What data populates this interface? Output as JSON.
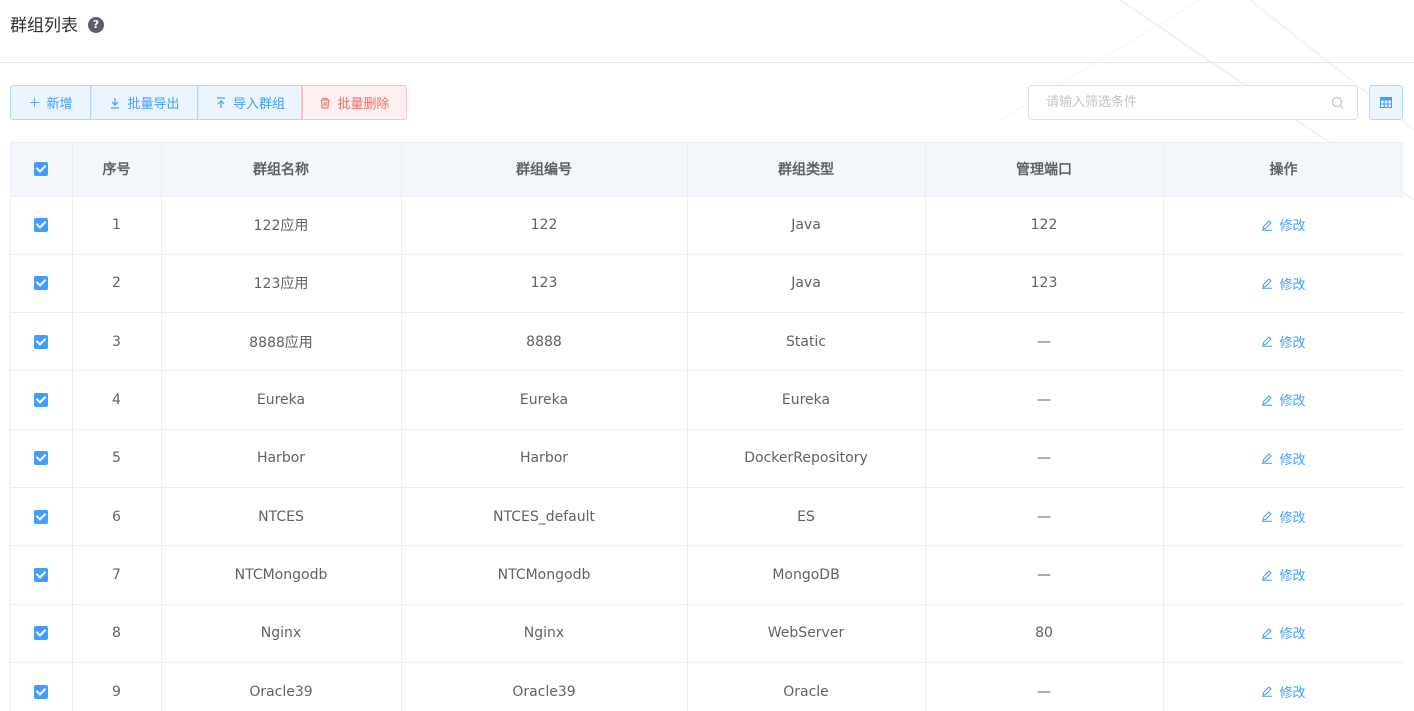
{
  "header": {
    "title": "群组列表",
    "help_symbol": "?"
  },
  "toolbar": {
    "add_label": "新增",
    "export_label": "批量导出",
    "import_label": "导入群组",
    "delete_label": "批量删除",
    "add_icon": "plus-icon",
    "export_icon": "download-icon",
    "import_icon": "upload-icon",
    "delete_icon": "trash-icon"
  },
  "search": {
    "placeholder": "请输入筛选条件",
    "value": ""
  },
  "colors": {
    "primary": "#409eff",
    "danger": "#f56c6c",
    "header_bg": "#f3f6fb"
  },
  "table": {
    "columns": [
      "序号",
      "群组名称",
      "群组编号",
      "群组类型",
      "管理端口",
      "操作"
    ],
    "action_label": "修改",
    "rows": [
      {
        "index": "1",
        "name": "122应用",
        "code": "122",
        "type": "Java",
        "port": "122",
        "checked": true
      },
      {
        "index": "2",
        "name": "123应用",
        "code": "123",
        "type": "Java",
        "port": "123",
        "checked": true
      },
      {
        "index": "3",
        "name": "8888应用",
        "code": "8888",
        "type": "Static",
        "port": "—",
        "checked": true
      },
      {
        "index": "4",
        "name": "Eureka",
        "code": "Eureka",
        "type": "Eureka",
        "port": "—",
        "checked": true
      },
      {
        "index": "5",
        "name": "Harbor",
        "code": "Harbor",
        "type": "DockerRepository",
        "port": "—",
        "checked": true
      },
      {
        "index": "6",
        "name": "NTCES",
        "code": "NTCES_default",
        "type": "ES",
        "port": "—",
        "checked": true
      },
      {
        "index": "7",
        "name": "NTCMongodb",
        "code": "NTCMongodb",
        "type": "MongoDB",
        "port": "—",
        "checked": true
      },
      {
        "index": "8",
        "name": "Nginx",
        "code": "Nginx",
        "type": "WebServer",
        "port": "80",
        "checked": true
      },
      {
        "index": "9",
        "name": "Oracle39",
        "code": "Oracle39",
        "type": "Oracle",
        "port": "—",
        "checked": true
      }
    ]
  }
}
